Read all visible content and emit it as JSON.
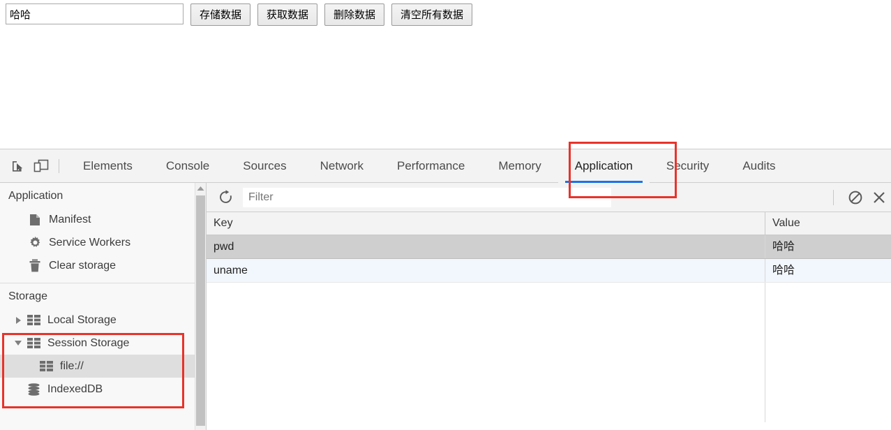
{
  "page": {
    "input": {
      "value": "哈哈",
      "placeholder": ""
    },
    "buttons": [
      {
        "name": "save-data-button",
        "label": "存储数据"
      },
      {
        "name": "get-data-button",
        "label": "获取数据"
      },
      {
        "name": "delete-data-button",
        "label": "删除数据"
      },
      {
        "name": "clear-all-data-button",
        "label": "清空所有数据"
      }
    ]
  },
  "devtools": {
    "left_icons": [
      {
        "name": "inspect-element-icon",
        "title": "Inspect element"
      },
      {
        "name": "device-toolbar-icon",
        "title": "Toggle device toolbar"
      }
    ],
    "tabs": [
      {
        "label": "Elements",
        "active": false
      },
      {
        "label": "Console",
        "active": false
      },
      {
        "label": "Sources",
        "active": false
      },
      {
        "label": "Network",
        "active": false
      },
      {
        "label": "Performance",
        "active": false
      },
      {
        "label": "Memory",
        "active": false
      },
      {
        "label": "Application",
        "active": true
      },
      {
        "label": "Security",
        "active": false
      },
      {
        "label": "Audits",
        "active": false
      }
    ],
    "active_tab": "Application",
    "accent_color": "#1a73e8",
    "annotation_color": "#e8332a",
    "sidebar": {
      "section_application": {
        "title": "Application",
        "items": [
          {
            "label": "Manifest",
            "icon": "document-icon"
          },
          {
            "label": "Service Workers",
            "icon": "gear-icon"
          },
          {
            "label": "Clear storage",
            "icon": "trash-icon"
          }
        ]
      },
      "section_storage": {
        "title": "Storage",
        "items": [
          {
            "label": "Local Storage",
            "icon": "table-grid-icon",
            "twisty": "collapsed",
            "selected": false
          },
          {
            "label": "Session Storage",
            "icon": "table-grid-icon",
            "twisty": "expanded",
            "selected": false
          },
          {
            "label": "file://",
            "icon": "table-grid-icon",
            "twisty": "none",
            "selected": true
          },
          {
            "label": "IndexedDB",
            "icon": "database-icon",
            "twisty": "none",
            "selected": false
          }
        ]
      }
    },
    "toolbar": {
      "refresh_icon": "refresh-icon",
      "filter_placeholder": "Filter",
      "filter_value": "",
      "clear_icon": "no-entry-icon",
      "delete_icon": "close-x-icon"
    },
    "table": {
      "columns": [
        "Key",
        "Value"
      ],
      "rows": [
        {
          "key": "pwd",
          "value": "哈哈",
          "selected": true
        },
        {
          "key": "uname",
          "value": "哈哈",
          "selected": false
        }
      ]
    }
  }
}
